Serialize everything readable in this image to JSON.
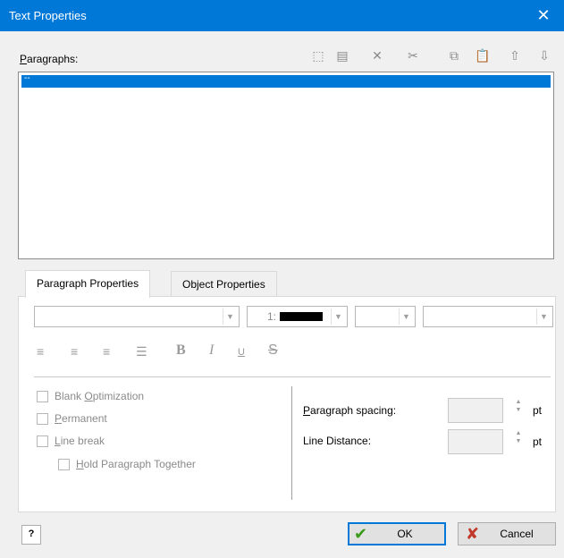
{
  "window": {
    "title": "Text Properties",
    "close_glyph": "✕"
  },
  "paragraphs": {
    "label_prefix": "",
    "label_hotkey": "P",
    "label_rest": "aragraphs:",
    "selected_item": "--"
  },
  "toolbar": [
    {
      "name": "new-paragraph-icon",
      "glyph": "⬚"
    },
    {
      "name": "properties-icon",
      "glyph": "▤"
    },
    {
      "name": "delete-icon",
      "glyph": "✕"
    },
    {
      "name": "cut-icon",
      "glyph": "✂"
    },
    {
      "name": "copy-icon",
      "glyph": "⧉"
    },
    {
      "name": "paste-icon",
      "glyph": "📋"
    },
    {
      "name": "move-up-icon",
      "glyph": "⇧"
    },
    {
      "name": "move-down-icon",
      "glyph": "⇩"
    }
  ],
  "tabs": [
    {
      "label": "Paragraph Properties",
      "active": true
    },
    {
      "label": "Object Properties",
      "active": false
    }
  ],
  "font": {
    "family_value": "",
    "color_value": "1:",
    "size_value": "",
    "style_value": "",
    "color_swatch": "#000000"
  },
  "format_buttons": {
    "align_left": "≡",
    "align_center": "≡",
    "align_right": "≡",
    "justify": "☰",
    "bold": "B",
    "italic": "I",
    "underline": "U",
    "strike": "S"
  },
  "options": {
    "blank_prefix": "Blank ",
    "blank_hotkey": "O",
    "blank_rest": "ptimization",
    "permanent_prefix": "",
    "permanent_hotkey": "P",
    "permanent_rest": "ermanent",
    "linebreak_prefix": "",
    "linebreak_hotkey": "L",
    "linebreak_rest": "ine break",
    "hold_prefix": "",
    "hold_hotkey": "H",
    "hold_rest": "old Paragraph Together"
  },
  "spacing": {
    "para_hotkey": "P",
    "para_rest": "aragraph spacing:",
    "line_label": "Line Distance:",
    "unit": "pt"
  },
  "buttons": {
    "help_glyph": "?",
    "ok_label": "OK",
    "cancel_label": "Cancel",
    "ok_color": "#3a9a1a",
    "cancel_color": "#c0392b"
  }
}
